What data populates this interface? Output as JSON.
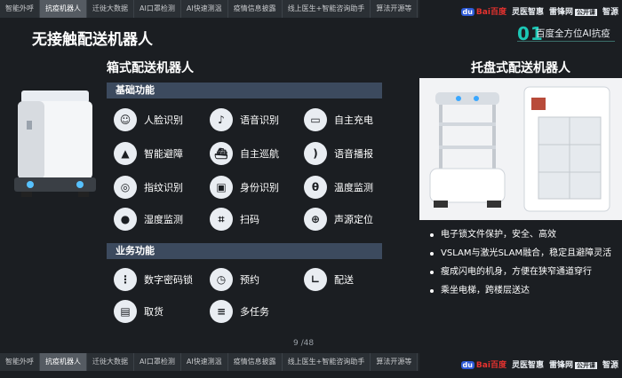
{
  "tabs": [
    {
      "label": "智能外呼",
      "active": false
    },
    {
      "label": "抗疫机器人",
      "active": true
    },
    {
      "label": "迁徙大数据",
      "active": false
    },
    {
      "label": "AI口罩检测",
      "active": false
    },
    {
      "label": "AI快速测温",
      "active": false
    },
    {
      "label": "疫情信息披露",
      "active": false
    },
    {
      "label": "线上医生+智能咨询助手",
      "active": false
    },
    {
      "label": "算法开源等",
      "active": false
    }
  ],
  "brands": {
    "baidu": "Bai百度",
    "lingyi": "灵医智惠",
    "leifeng": "雷锋网",
    "leifeng_box": "公开课",
    "zhiyuan": "智源"
  },
  "page": {
    "title": "无接触配送机器人",
    "section_number": "01",
    "section_label": "百度全方位AI抗疫",
    "page_number": "9 /48"
  },
  "left": {
    "title": "箱式配送机器人",
    "basic_header": "基础功能",
    "biz_header": "业务功能",
    "basic_features": [
      {
        "label": "人脸识别",
        "icon": "face-icon",
        "glyph": "☺"
      },
      {
        "label": "语音识别",
        "icon": "microphone-icon",
        "glyph": "♪"
      },
      {
        "label": "自主充电",
        "icon": "battery-icon",
        "glyph": "▭"
      },
      {
        "label": "智能避障",
        "icon": "cone-icon",
        "glyph": "▲"
      },
      {
        "label": "自主巡航",
        "icon": "ship-icon",
        "glyph": "⛴"
      },
      {
        "label": "语音播报",
        "icon": "broadcast-icon",
        "glyph": ")"
      },
      {
        "label": "指纹识别",
        "icon": "fingerprint-icon",
        "glyph": "◎"
      },
      {
        "label": "身份识别",
        "icon": "id-card-icon",
        "glyph": "▣"
      },
      {
        "label": "温度监测",
        "icon": "thermometer-icon",
        "glyph": "θ"
      },
      {
        "label": "湿度监测",
        "icon": "droplet-icon",
        "glyph": "●"
      },
      {
        "label": "扫码",
        "icon": "scan-icon",
        "glyph": "⌗"
      },
      {
        "label": "声源定位",
        "icon": "target-icon",
        "glyph": "⊕"
      }
    ],
    "biz_features": [
      {
        "label": "数字密码锁",
        "icon": "keypad-icon",
        "glyph": "⋮"
      },
      {
        "label": "预约",
        "icon": "clock-icon",
        "glyph": "◷"
      },
      {
        "label": "配送",
        "icon": "delivery-icon",
        "glyph": "∟"
      },
      {
        "label": "取货",
        "icon": "package-icon",
        "glyph": "▤"
      },
      {
        "label": "多任务",
        "icon": "list-icon",
        "glyph": "≡"
      }
    ]
  },
  "right": {
    "title": "托盘式配送机器人",
    "bullets": [
      "电子锁文件保护，安全、高效",
      "VSLAM与激光SLAM融合，稳定且避障灵活",
      "瘦成闪电的机身，方便在狭窄通道穿行",
      "乘坐电梯，跨楼层送达"
    ]
  }
}
